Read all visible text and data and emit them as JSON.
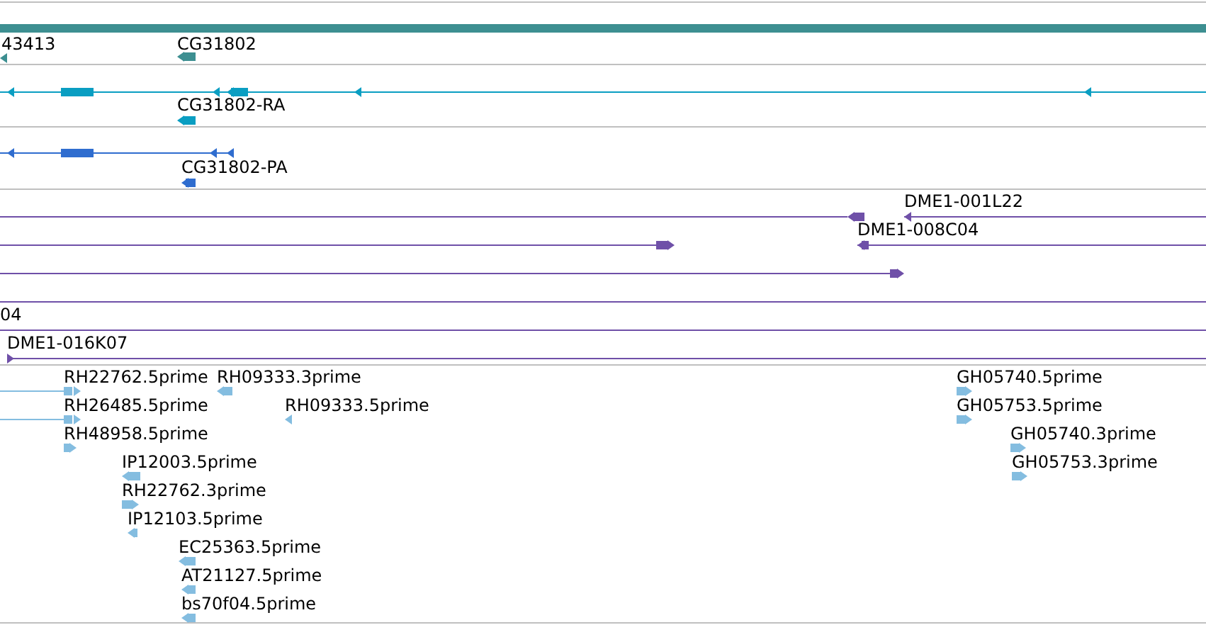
{
  "tracks": [
    {
      "color": "#3d8f91",
      "features": [
        {
          "kind": "bar"
        },
        {
          "kind": "feature",
          "label": "43413",
          "reverse": true
        },
        {
          "kind": "feature",
          "label": "CG31802",
          "reverse": true
        }
      ]
    },
    {
      "color": "#0a9ec2",
      "features": [
        {
          "reverse": true
        },
        {
          "label": "CG31802-RA",
          "reverse": true
        }
      ]
    },
    {
      "color": "#2f6dcf",
      "features": [
        {
          "reverse": true
        },
        {
          "label": "CG31802-PA",
          "reverse": true
        }
      ]
    },
    {
      "color": "#6f50a8",
      "features": [
        {
          "kind": "feature",
          "reverse": true
        },
        {
          "kind": "feature",
          "label": "DME1-001L22",
          "reverse": true
        },
        {
          "kind": "feature",
          "reverse": false
        },
        {
          "kind": "feature",
          "label": "DME1-008C04",
          "reverse": true
        },
        {
          "kind": "feature",
          "reverse": false
        },
        {
          "kind": "feature"
        },
        {
          "kind": "feature",
          "label": "04"
        },
        {
          "kind": "feature",
          "label": "DME1-016K07",
          "reverse": false
        }
      ]
    },
    {
      "color": "#84bde0",
      "features": [
        {
          "label": "RH22762.5prime",
          "reverse": false
        },
        {
          "label": "RH09333.3prime",
          "reverse": true
        },
        {
          "label": "RH26485.5prime",
          "reverse": false
        },
        {
          "label": "RH09333.5prime",
          "reverse": true
        },
        {
          "label": "RH48958.5prime",
          "reverse": false
        },
        {
          "label": "IP12003.5prime",
          "reverse": true
        },
        {
          "label": "RH22762.3prime",
          "reverse": false
        },
        {
          "label": "IP12103.5prime",
          "reverse": true
        },
        {
          "label": "EC25363.5prime",
          "reverse": true
        },
        {
          "label": "AT21127.5prime",
          "reverse": true
        },
        {
          "label": "bs70f04.5prime",
          "reverse": true
        },
        {
          "label": "GH05740.5prime",
          "reverse": false
        },
        {
          "label": "GH05753.5prime",
          "reverse": false
        },
        {
          "label": "GH05740.3prime",
          "reverse": false
        },
        {
          "label": "GH05753.3prime",
          "reverse": false
        }
      ]
    }
  ]
}
